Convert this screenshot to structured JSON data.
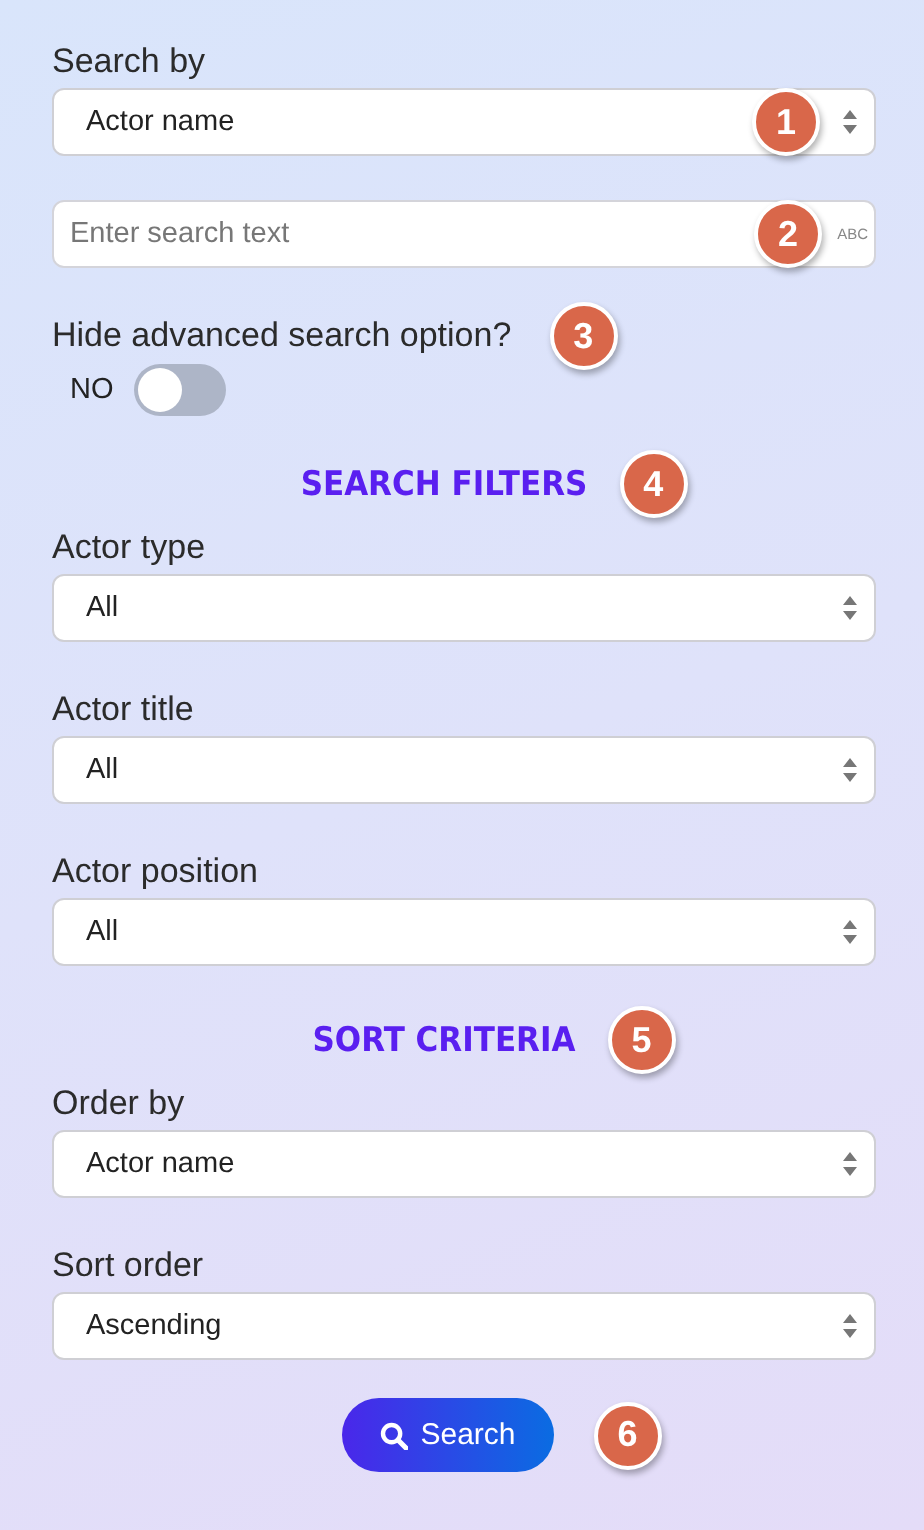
{
  "rows": [
    {
      "kind": "select",
      "label": "Search by",
      "value": "Actor name",
      "badge": "1"
    },
    {
      "kind": "text",
      "placeholder": "Enter search text",
      "suffix": "ABC",
      "badge": "2"
    },
    {
      "kind": "toggle",
      "label": "Hide advanced search option?",
      "state_label": "NO",
      "on": false,
      "badge": "3"
    },
    {
      "kind": "heading",
      "text": "SEARCH FILTERS",
      "badge": "4"
    },
    {
      "kind": "select",
      "label": "Actor type",
      "value": "All"
    },
    {
      "kind": "select",
      "label": "Actor title",
      "value": "All"
    },
    {
      "kind": "select",
      "label": "Actor position",
      "value": "All"
    },
    {
      "kind": "heading",
      "text": "SORT CRITERIA",
      "badge": "5"
    },
    {
      "kind": "select",
      "label": "Order by",
      "value": "Actor name"
    },
    {
      "kind": "select",
      "label": "Sort order",
      "value": "Ascending"
    },
    {
      "kind": "button",
      "label": "Search",
      "badge": "6"
    }
  ]
}
